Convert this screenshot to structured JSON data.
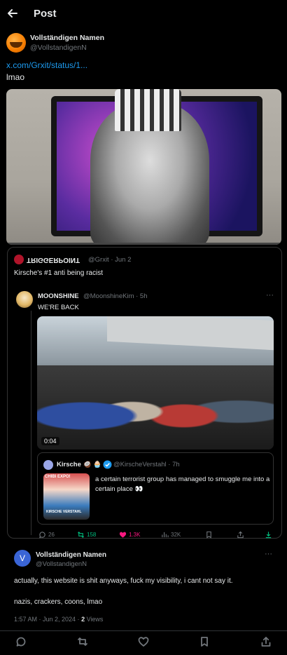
{
  "header": {
    "title": "Post",
    "back_icon": "arrow-left-icon"
  },
  "post": {
    "author_name": "Vollständigen Namen",
    "author_handle": "@VollstandigenN",
    "link_text": "x.com/Grxit/status/1...",
    "text": "lmao"
  },
  "quote": {
    "author_name": "TRIGGERPOINT",
    "author_handle": "@Grxit · Jun 2",
    "text": "Kirsche's #1 anti being racist",
    "reply": {
      "author_name": "MOONSHINE",
      "author_handle": "@MoonshineKim · 5h",
      "text": "WE'RE BACK",
      "video_time": "0:04",
      "inner_quote": {
        "author_name": "Kirsche 🥥 🧁",
        "author_handle": "@KirscheVerstahl · 7h",
        "text": "a certain terrorist group has managed to smuggle me into a certain place 👀",
        "image_title": "CHIBI EXPO!",
        "image_sub": "KIRSCHE VERSTAHL"
      },
      "actions": {
        "replies": "26",
        "reposts": "158",
        "likes": "1.3K",
        "views": "32K"
      }
    }
  },
  "reply": {
    "avatar_letter": "V",
    "author_name": "Vollständigen Namen",
    "author_handle": "@VollstandigenN",
    "text1": "actually, this website is shit anyways, fuck my visibility, i cant not say it.",
    "text2": "nazis, crackers, coons, lmao",
    "meta_time": "1:57 AM · Jun 2, 2024 · ",
    "meta_views_count": "2",
    "meta_views_label": " Views"
  },
  "more_label": "···",
  "colors": {
    "accent": "#1d9bf0",
    "repost": "#00ba7c",
    "like": "#f91880",
    "muted": "#71767b"
  }
}
